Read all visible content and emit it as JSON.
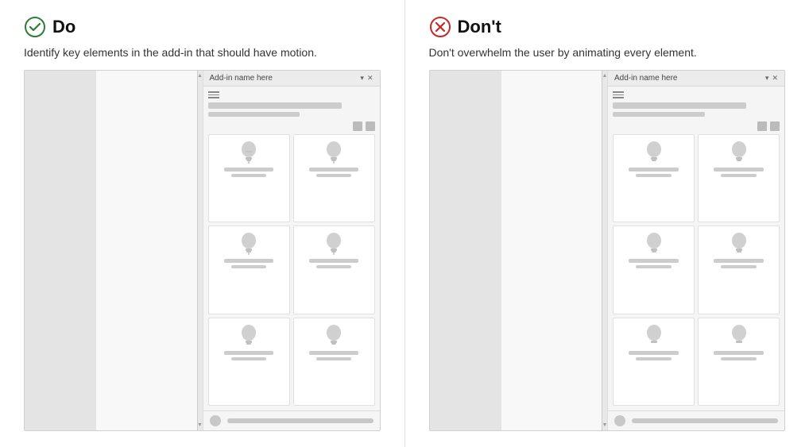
{
  "do_panel": {
    "icon": "check-circle-icon",
    "title": "Do",
    "description": "Identify key elements in the add-in that should have motion.",
    "addin_name": "Add-in name here",
    "icon_color": "#2e7d32"
  },
  "dont_panel": {
    "icon": "x-circle-icon",
    "title": "Don't",
    "description": "Don't overwhelm the user by animating every element.",
    "addin_name": "Add-in name here",
    "icon_color": "#c62828"
  }
}
